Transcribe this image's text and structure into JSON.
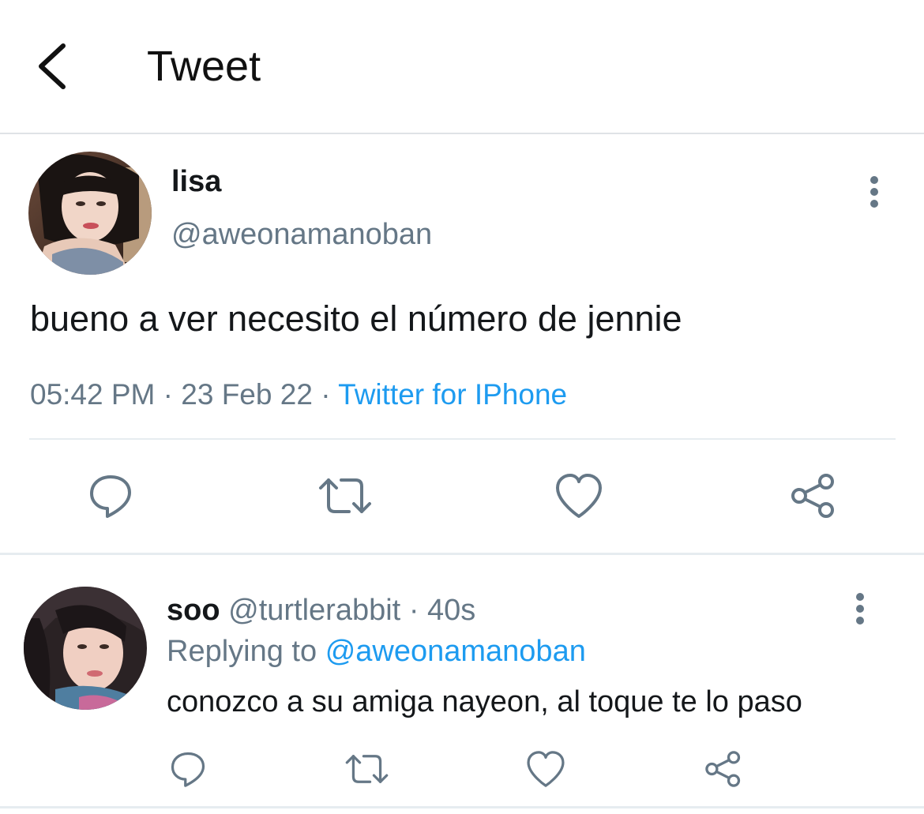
{
  "header": {
    "title": "Tweet",
    "back_icon": "chevron-left-icon"
  },
  "tweet": {
    "author_name": "lisa",
    "author_handle": "@aweonamanoban",
    "text": "bueno a ver necesito el número de jennie",
    "time": "05:42 PM",
    "date": "23 Feb 22",
    "source": "Twitter for IPhone",
    "separator": "·",
    "actions": [
      "reply-icon",
      "retweet-icon",
      "like-icon",
      "share-icon"
    ]
  },
  "reply": {
    "author_name": "soo",
    "author_handle": "@turtlerabbit",
    "age": "40s",
    "separator": "·",
    "replying_prefix": "Replying to",
    "replying_to": "@aweonamanoban",
    "text": "conozco a su amiga nayeon, al toque te lo paso"
  },
  "colors": {
    "text_primary": "#14171a",
    "text_secondary": "#657786",
    "link": "#1d9bf0",
    "icon": "#657786",
    "divider": "#e6ecf0"
  }
}
